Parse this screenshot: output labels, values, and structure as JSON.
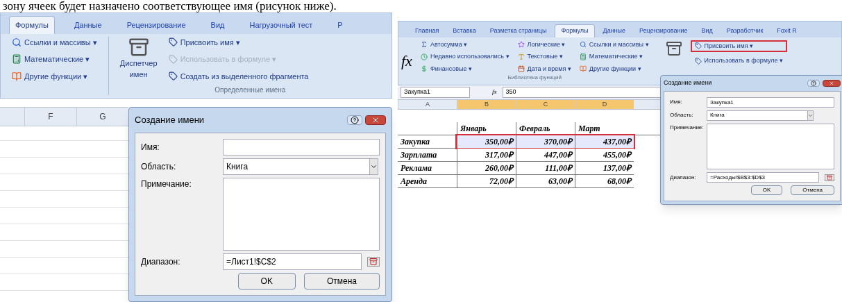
{
  "article_text": "зону ячеек будет назначено соответствующее имя (рисунок ниже).",
  "left_screenshot": {
    "tabs": [
      {
        "label": "Формулы",
        "selected": true
      },
      {
        "label": "Данные",
        "selected": false
      },
      {
        "label": "Рецензирование",
        "selected": false
      },
      {
        "label": "Вид",
        "selected": false
      },
      {
        "label": "Нагрузочный тест",
        "selected": false
      },
      {
        "label": "Р",
        "selected": false
      }
    ],
    "function_items": [
      {
        "label": "Ссылки и массивы ▾",
        "kind": "lookup"
      },
      {
        "label": "Математические ▾",
        "kind": "math"
      },
      {
        "label": "Другие функции ▾",
        "kind": "other"
      }
    ],
    "manager_button": "Диспетчер имен",
    "name_commands": [
      {
        "label": "Присвоить имя ▾",
        "disabled": false
      },
      {
        "label": "Использовать в формуле ▾",
        "disabled": true
      },
      {
        "label": "Создать из выделенного фрагмента",
        "disabled": false
      }
    ],
    "group_label": "Определенные имена",
    "columns": [
      "F",
      "G"
    ],
    "dialog": {
      "title": "Создание имени",
      "name_label": "Имя:",
      "scope_label": "Область:",
      "scope_value": "Книга",
      "comment_label": "Примечание:",
      "range_label": "Диапазон:",
      "range_value": "=Лист1!$C$2",
      "buttons": [
        "OK",
        "Отмена"
      ]
    }
  },
  "right_screenshot": {
    "tabs": [
      {
        "label": "Главная",
        "selected": false
      },
      {
        "label": "Вставка",
        "selected": false
      },
      {
        "label": "Разметка страницы",
        "selected": false
      },
      {
        "label": "Формулы",
        "selected": true
      },
      {
        "label": "Данные",
        "selected": false
      },
      {
        "label": "Рецензирование",
        "selected": false
      },
      {
        "label": "Вид",
        "selected": false
      },
      {
        "label": "Разработчик",
        "selected": false
      },
      {
        "label": "Foxit R",
        "selected": false
      }
    ],
    "insert_function": "fx",
    "function_columns": [
      [
        {
          "label": "Автосумма ▾",
          "kind": "sum"
        },
        {
          "label": "Недавно использовались ▾",
          "kind": "recent"
        },
        {
          "label": "Финансовые ▾",
          "kind": "finance"
        }
      ],
      [
        {
          "label": "Логические ▾",
          "kind": "logic"
        },
        {
          "label": "Текстовые ▾",
          "kind": "text"
        },
        {
          "label": "Дата и время ▾",
          "kind": "date"
        }
      ],
      [
        {
          "label": "Ссылки и массивы ▾",
          "kind": "lookup"
        },
        {
          "label": "Математические ▾",
          "kind": "math"
        },
        {
          "label": "Другие функции ▾",
          "kind": "other"
        }
      ]
    ],
    "group_label": "Библиотека функций",
    "name_commands": [
      {
        "label": "Присвоить имя ▾",
        "highlighted": true
      },
      {
        "label": "Использовать в формуле ▾",
        "highlighted": false
      }
    ],
    "name_box": "Закупка1",
    "formula_label": "fx",
    "formula_value": "350",
    "columns": [
      {
        "label": "A",
        "selected": false
      },
      {
        "label": "B",
        "selected": true
      },
      {
        "label": "C",
        "selected": true
      },
      {
        "label": "D",
        "selected": true
      }
    ],
    "table_header": [
      "Январь",
      "Февраль",
      "Март"
    ],
    "rows": [
      {
        "label": "Закупка",
        "values": [
          "350,00₽",
          "370,00₽",
          "437,00₽"
        ],
        "highlighted": true
      },
      {
        "label": "Зарплата",
        "values": [
          "317,00₽",
          "447,00₽",
          "455,00₽"
        ],
        "highlighted": false
      },
      {
        "label": "Реклама",
        "values": [
          "260,00₽",
          "111,00₽",
          "137,00₽"
        ],
        "highlighted": false
      },
      {
        "label": "Аренда",
        "values": [
          "72,00₽",
          "63,00₽",
          "68,00₽"
        ],
        "highlighted": false
      }
    ],
    "dialog": {
      "title": "Создание имени",
      "name_label": "Имя:",
      "name_value": "Закупка1",
      "scope_label": "Область:",
      "scope_value": "Книга",
      "comment_label": "Примечание:",
      "range_label": "Диапазон:",
      "range_value": "=Расходы!$B$3:$D$3",
      "buttons": [
        "OK",
        "Отмена"
      ]
    }
  }
}
